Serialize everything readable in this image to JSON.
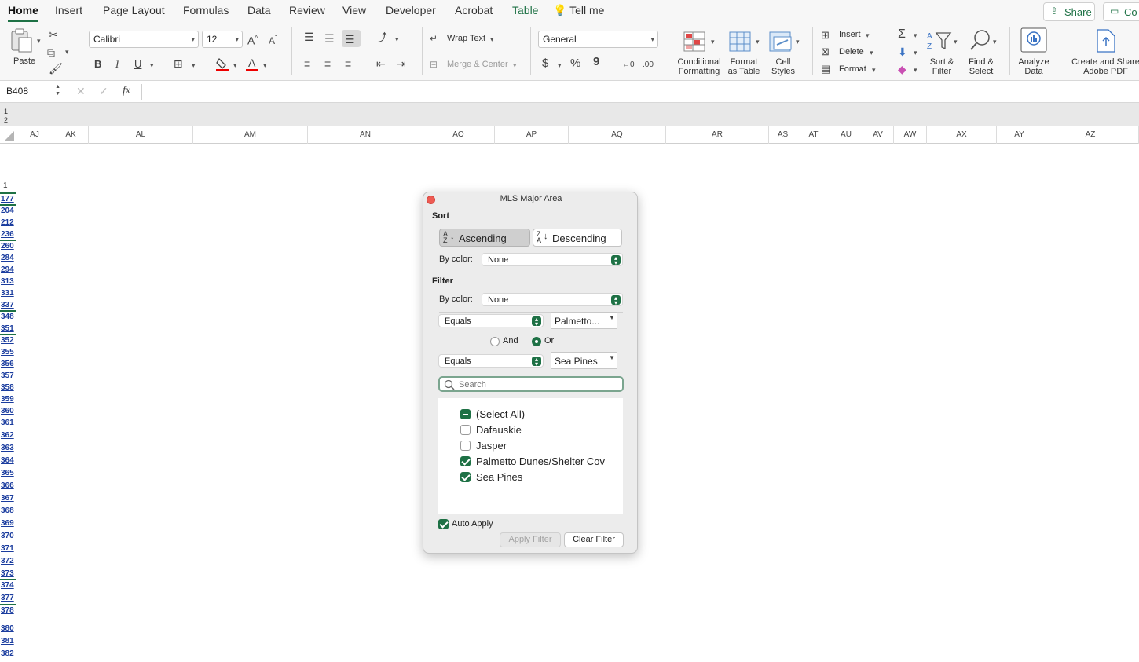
{
  "tabs": [
    {
      "label": "Home"
    },
    {
      "label": "Insert"
    },
    {
      "label": "Page Layout"
    },
    {
      "label": "Formulas"
    },
    {
      "label": "Data"
    },
    {
      "label": "Review"
    },
    {
      "label": "View"
    },
    {
      "label": "Developer"
    },
    {
      "label": "Acrobat"
    },
    {
      "label": "Table"
    },
    {
      "label": "Tell me"
    }
  ],
  "share_label": "Share",
  "comments_label": "Co",
  "ribbon": {
    "paste": "Paste",
    "font_name": "Calibri",
    "font_size": "12",
    "bold": "B",
    "italic": "I",
    "underline": "U",
    "wrap_text": "Wrap Text",
    "merge_center": "Merge & Center",
    "number_format": "General",
    "currency": "$",
    "percent": "%",
    "comma": "9",
    "conditional": [
      "Conditional",
      "Formatting"
    ],
    "format_table": [
      "Format",
      "as Table"
    ],
    "cell_styles": [
      "Cell",
      "Styles"
    ],
    "insert": "Insert",
    "delete": "Delete",
    "format": "Format",
    "sort_filter": [
      "Sort &",
      "Filter"
    ],
    "find_select": [
      "Find &",
      "Select"
    ],
    "analyze": [
      "Analyze",
      "Data"
    ],
    "adobe": [
      "Create and Share",
      "Adobe PDF"
    ]
  },
  "formula_bar": {
    "name_box": "B408",
    "fx": "fx"
  },
  "outline_levels": [
    "1",
    "2"
  ],
  "columns": [
    "AJ",
    "AK",
    "AL",
    "AM",
    "AN",
    "AO",
    "AP",
    "AQ",
    "AR",
    "AS",
    "AT",
    "AU",
    "AV",
    "AW",
    "AX",
    "AY",
    "AZ"
  ],
  "header_row": "1",
  "rows": [
    "177",
    "204",
    "212",
    "236",
    "260",
    "284",
    "294",
    "313",
    "331",
    "337",
    "348",
    "351",
    "352",
    "355",
    "356",
    "357",
    "358",
    "359",
    "360",
    "361",
    "362",
    "363",
    "364",
    "365",
    "366",
    "367",
    "368",
    "369",
    "370",
    "371",
    "372",
    "373",
    "374",
    "377",
    "378",
    "380",
    "381",
    "382"
  ],
  "dialog": {
    "title": "MLS Major Area",
    "sort_heading": "Sort",
    "ascending": "Ascending",
    "descending": "Descending",
    "by_color_label": "By color:",
    "sort_color": "None",
    "filter_heading": "Filter",
    "filter_color": "None",
    "cond1_op": "Equals",
    "cond1_val": "Palmetto...",
    "and_label": "And",
    "or_label": "Or",
    "cond2_op": "Equals",
    "cond2_val": "Sea Pines",
    "search_placeholder": "Search",
    "items": [
      {
        "label": "(Select All)",
        "state": "mixed"
      },
      {
        "label": "Dafauskie",
        "state": "off"
      },
      {
        "label": "Jasper",
        "state": "off"
      },
      {
        "label": "Palmetto Dunes/Shelter Cov",
        "state": "on"
      },
      {
        "label": "Sea Pines",
        "state": "on"
      }
    ],
    "auto_apply": "Auto Apply",
    "apply_filter": "Apply Filter",
    "clear_filter": "Clear Filter"
  }
}
